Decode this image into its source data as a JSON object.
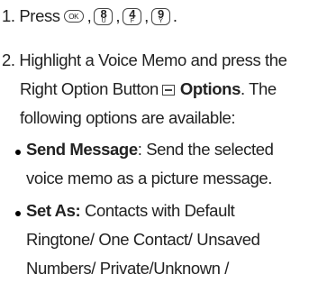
{
  "step1": {
    "prefix": "1. Press",
    "ok_key": "OK",
    "keys": [
      {
        "main": "8",
        "sub": "U"
      },
      {
        "main": "4",
        "sub": "F"
      },
      {
        "main": "9",
        "sub": "Y"
      }
    ],
    "sep": ",",
    "end": "."
  },
  "step2": {
    "line1": "2. Highlight a Voice Memo and press the",
    "line2_pre": "Right Option Button",
    "button_icon": "right-option-key-icon",
    "line2_bold": "Options",
    "line2_post": ". The",
    "line3": "following options are available:"
  },
  "options": [
    {
      "label": "Send Message",
      "line1_rest": ": Send the selected",
      "line2": "voice memo as a picture message."
    },
    {
      "label": "Set As:",
      "line1_rest": " Contacts with Default",
      "line2": "Ringtone/ One Contact/ Unsaved",
      "line3": "Numbers/ Private/Unknown /"
    }
  ]
}
